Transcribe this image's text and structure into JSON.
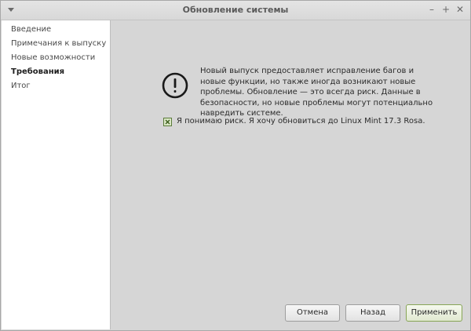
{
  "window": {
    "title": "Обновление системы",
    "controls": {
      "minimize": "–",
      "maximize": "+",
      "close": "✕"
    }
  },
  "sidebar": {
    "items": [
      {
        "label": "Введение",
        "active": false
      },
      {
        "label": "Примечания к выпуску",
        "active": false
      },
      {
        "label": "Новые возможности",
        "active": false
      },
      {
        "label": "Требования",
        "active": true
      },
      {
        "label": "Итог",
        "active": false
      }
    ]
  },
  "content": {
    "warning_icon": "exclamation-circle-icon",
    "message": "Новый выпуск предоставляет исправление багов и новые функции, но также иногда возникают новые проблемы. Обновление — это всегда риск. Данные в безопасности, но новые проблемы могут потенциально навредить системе.",
    "checkbox": {
      "label": "Я понимаю риск. Я хочу обновиться до Linux Mint 17.3 Rosa.",
      "checked": true
    }
  },
  "buttons": {
    "cancel": "Отмена",
    "back": "Назад",
    "apply": "Применить"
  },
  "colors": {
    "accent": "#87a556",
    "window_bg": "#d6d6d6",
    "sidebar_bg": "#ffffff"
  }
}
